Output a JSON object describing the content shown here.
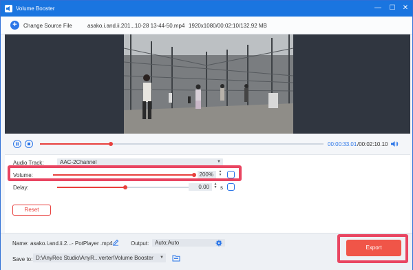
{
  "window": {
    "title": "Volume Booster"
  },
  "toolbar": {
    "change_source_label": "Change Source File",
    "file_name": "asako.i.and.ii.201...10-28 13-44-50.mp4",
    "file_info": "1920x1080/00:02:10/132.92 MB"
  },
  "player": {
    "current_time": "00:00:33.01",
    "total_time": "/00:02:10.10",
    "progress_fraction": 0.25
  },
  "settings": {
    "audio_track_label": "Audio Track:",
    "audio_track_value": "AAC-2Channel",
    "volume_label": "Volume:",
    "volume_value": "200%",
    "volume_fraction": 1.0,
    "delay_label": "Delay:",
    "delay_value": "0.00",
    "delay_unit": "s",
    "delay_fraction": 0.5,
    "reset_label": "Reset"
  },
  "output": {
    "name_label": "Name:",
    "name_value": "asako.i.and.ii.2...- PotPlayer .mp4",
    "output_label": "Output:",
    "output_value": "Auto;Auto",
    "save_to_label": "Save to:",
    "save_to_value": "D:\\AnyRec Studio\\AnyR...verter\\Volume Booster",
    "export_label": "Export"
  },
  "colors": {
    "titlebar": "#1a75e0",
    "accent": "#2b76e8",
    "slider": "#e8403d",
    "highlight": "#e94561",
    "export": "#f05548"
  }
}
